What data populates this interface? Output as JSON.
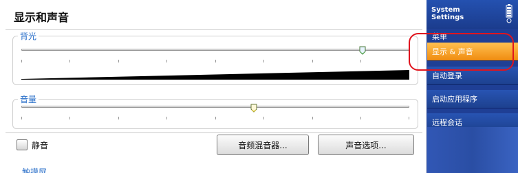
{
  "page": {
    "title": "显示和声音"
  },
  "backlight": {
    "legend": "背光",
    "level": 0.88
  },
  "volume": {
    "legend": "音量",
    "level": 0.6
  },
  "mute": {
    "label": "静音",
    "checked": false
  },
  "buttons": {
    "mixer": "音频混音器...",
    "sound_options": "声音选项..."
  },
  "cut_off_label": "触摸屏",
  "side_panel": {
    "title": "System\nSettings",
    "menu_label": "菜单",
    "items": [
      {
        "label": "显示 & 声音",
        "active": true
      },
      {
        "label": "自动登录",
        "active": false
      },
      {
        "label": "启动应用程序",
        "active": false
      },
      {
        "label": "远程会话",
        "active": false
      }
    ]
  },
  "colors": {
    "accent_blue": "#2a6fc9",
    "panel_blue": "#1f3f95",
    "active_orange": "#f5a020",
    "highlight_red": "#e0141e"
  }
}
